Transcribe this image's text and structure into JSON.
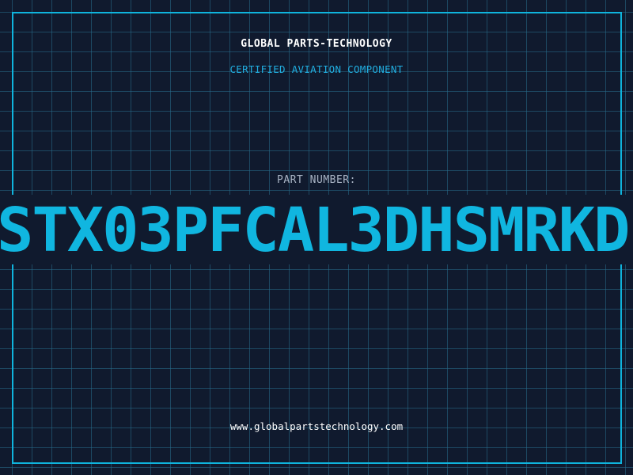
{
  "company_name": "GLOBAL PARTS-TECHNOLOGY",
  "subtitle": "CERTIFIED AVIATION COMPONENT",
  "part_number_label": "PART NUMBER:",
  "part_number": "STX03PFCAL3DHSMRKD",
  "website": "www.globalpartstechnology.com",
  "colors": {
    "background": "#101a2e",
    "accent": "#10b6e0",
    "grid": "#286e8c"
  }
}
